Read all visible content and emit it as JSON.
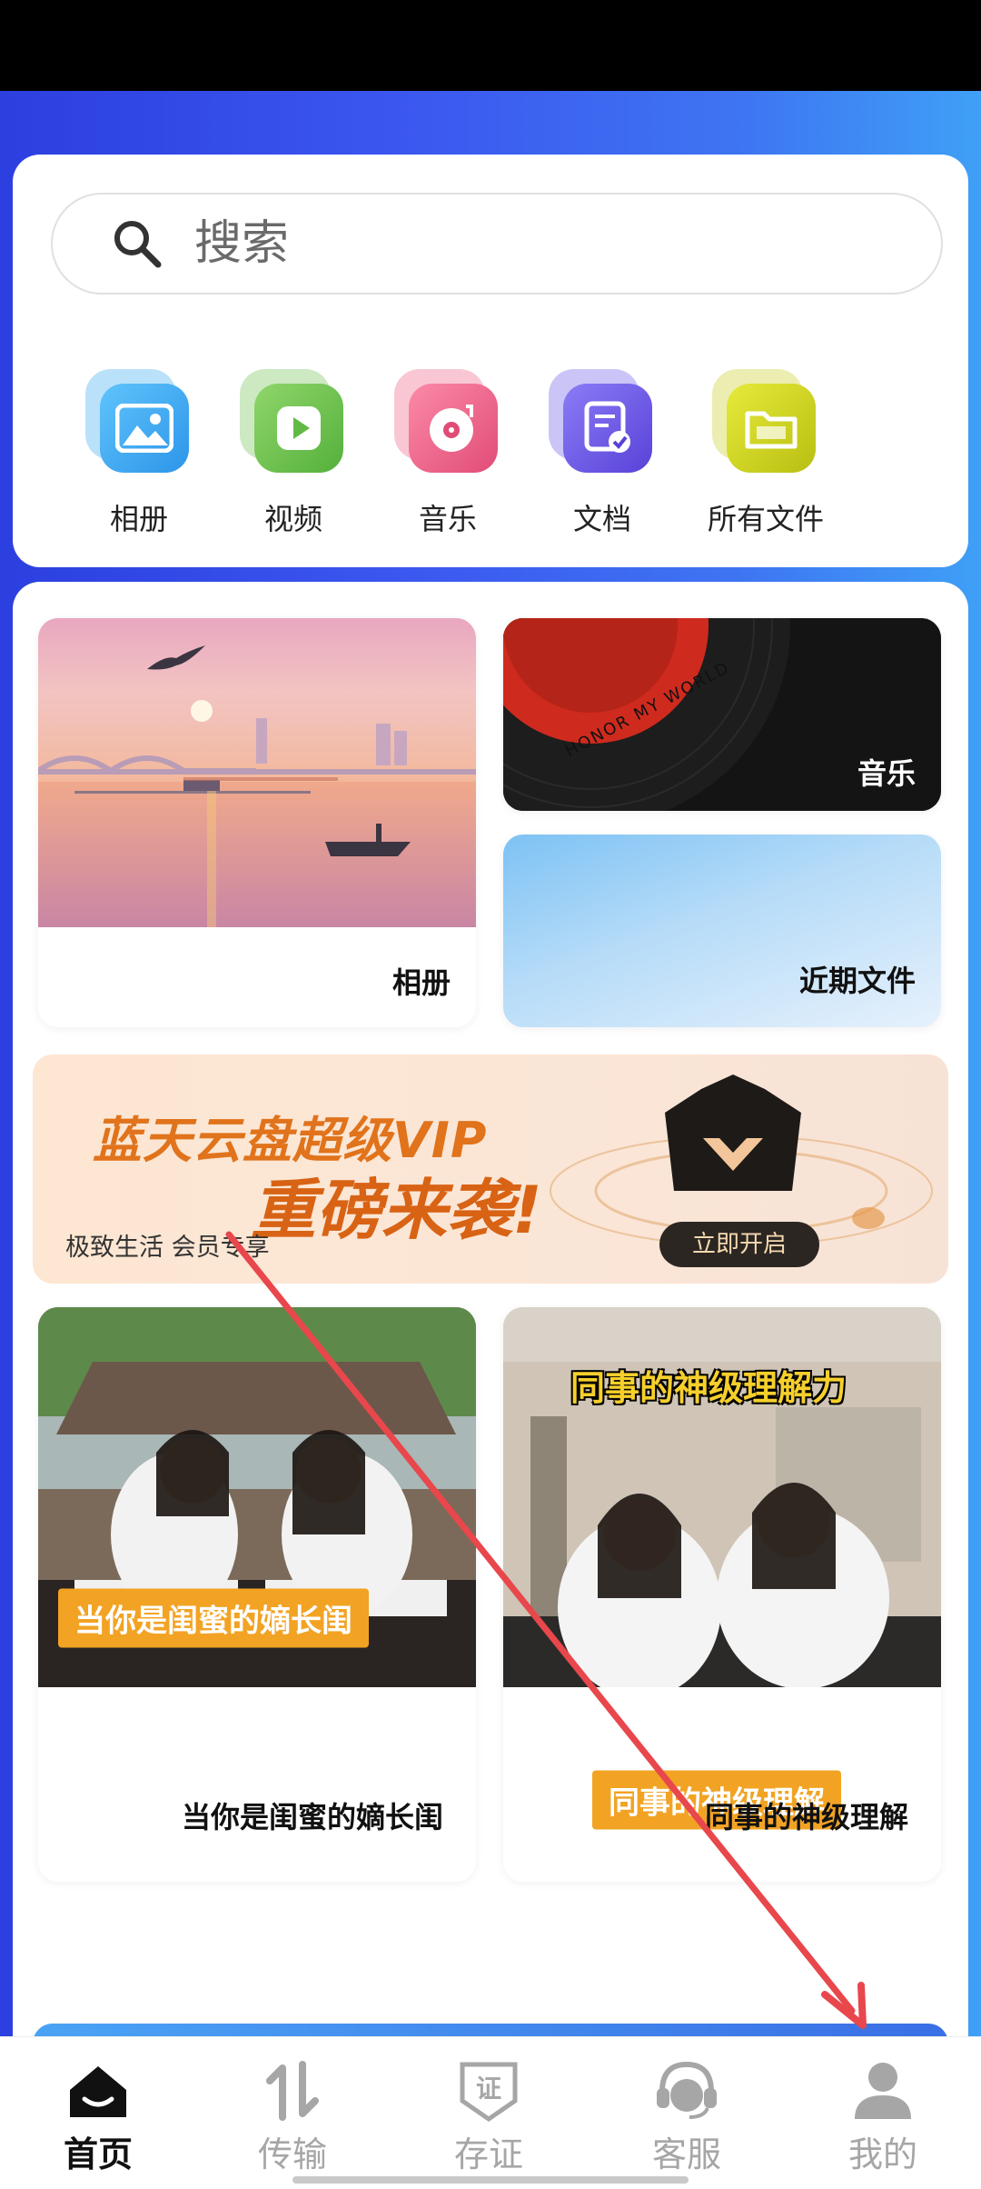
{
  "search": {
    "placeholder": "搜索"
  },
  "quick_access": [
    {
      "label": "相册",
      "icon": "photo-album-icon",
      "color": "#3aa8f0"
    },
    {
      "label": "视频",
      "icon": "video-play-icon",
      "color": "#6cc050"
    },
    {
      "label": "音乐",
      "icon": "music-disc-icon",
      "color": "#ee5d85"
    },
    {
      "label": "文档",
      "icon": "document-icon",
      "color": "#6a58e8"
    },
    {
      "label": "所有文件",
      "icon": "folder-icon",
      "color": "#c9cc1f"
    }
  ],
  "tiles": {
    "album": "相册",
    "music": "音乐",
    "recent": "近期文件"
  },
  "record_text": "HONOR MY WORLD",
  "banner": {
    "title_line1": "蓝天云盘超级VIP",
    "title_line2": "重磅来袭!",
    "subtitle": "极致生活   会员专享",
    "button": "立即开启"
  },
  "videos": [
    {
      "caption": "当你是闺蜜的嫡长闺",
      "title_overlay": "",
      "label": "当你是闺蜜的嫡长闺"
    },
    {
      "caption": "同事的神级理解",
      "title_overlay": "同事的神级理解力",
      "label": "同事的神级理解"
    }
  ],
  "bottom_nav": [
    {
      "label": "首页",
      "icon": "home-icon",
      "active": true
    },
    {
      "label": "传输",
      "icon": "transfer-icon",
      "active": false
    },
    {
      "label": "存证",
      "icon": "certificate-icon",
      "active": false
    },
    {
      "label": "客服",
      "icon": "customer-service-icon",
      "active": false
    },
    {
      "label": "我的",
      "icon": "profile-icon",
      "active": false
    }
  ],
  "colors": {
    "background_gradient_start": "#2c3fe0",
    "background_gradient_end": "#3fa0f6",
    "annotation_arrow": "#e8474c",
    "banner_text": "#e0731b"
  }
}
